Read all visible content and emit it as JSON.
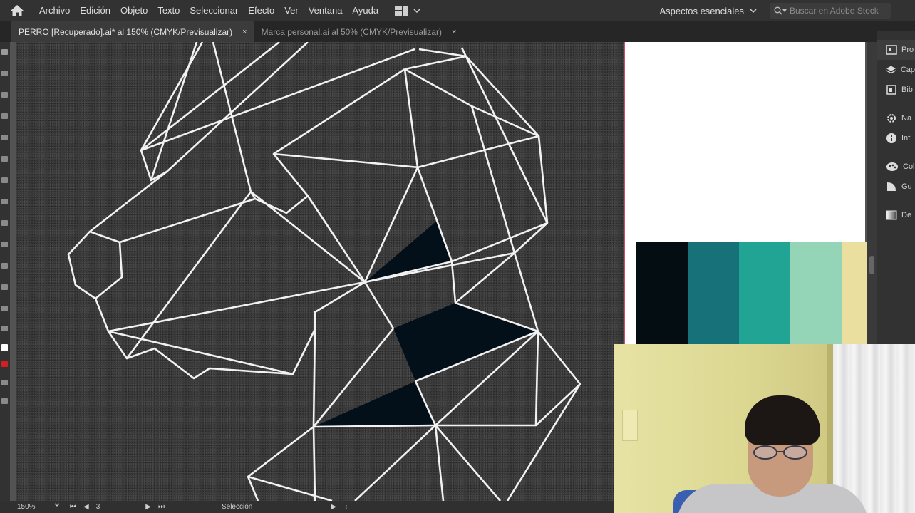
{
  "menubar": {
    "items": [
      "Archivo",
      "Edición",
      "Objeto",
      "Texto",
      "Seleccionar",
      "Efecto",
      "Ver",
      "Ventana",
      "Ayuda"
    ],
    "workspace": "Aspectos esenciales",
    "search_placeholder": "Buscar en Adobe Stock"
  },
  "tabs": [
    {
      "label": "PERRO [Recuperado].ai* al 150% (CMYK/Previsualizar)",
      "close": "×",
      "active": true
    },
    {
      "label": "Marca personal.ai al 50% (CMYK/Previsualizar)",
      "close": "×",
      "active": false
    }
  ],
  "panel": {
    "items": [
      "Pro",
      "Cap",
      "Bib",
      "Na",
      "Inf",
      "Col",
      "Gu",
      "De"
    ]
  },
  "palette": {
    "colors": [
      "#030d12",
      "#167178",
      "#22a495",
      "#94d4b7",
      "#eadf9f"
    ]
  },
  "statusbar": {
    "zoom": "150%",
    "artboard_number": "3",
    "tool": "Selección"
  },
  "artwork": {
    "stroke_color": "#f2f2f2",
    "fill_color": "#03101a"
  }
}
